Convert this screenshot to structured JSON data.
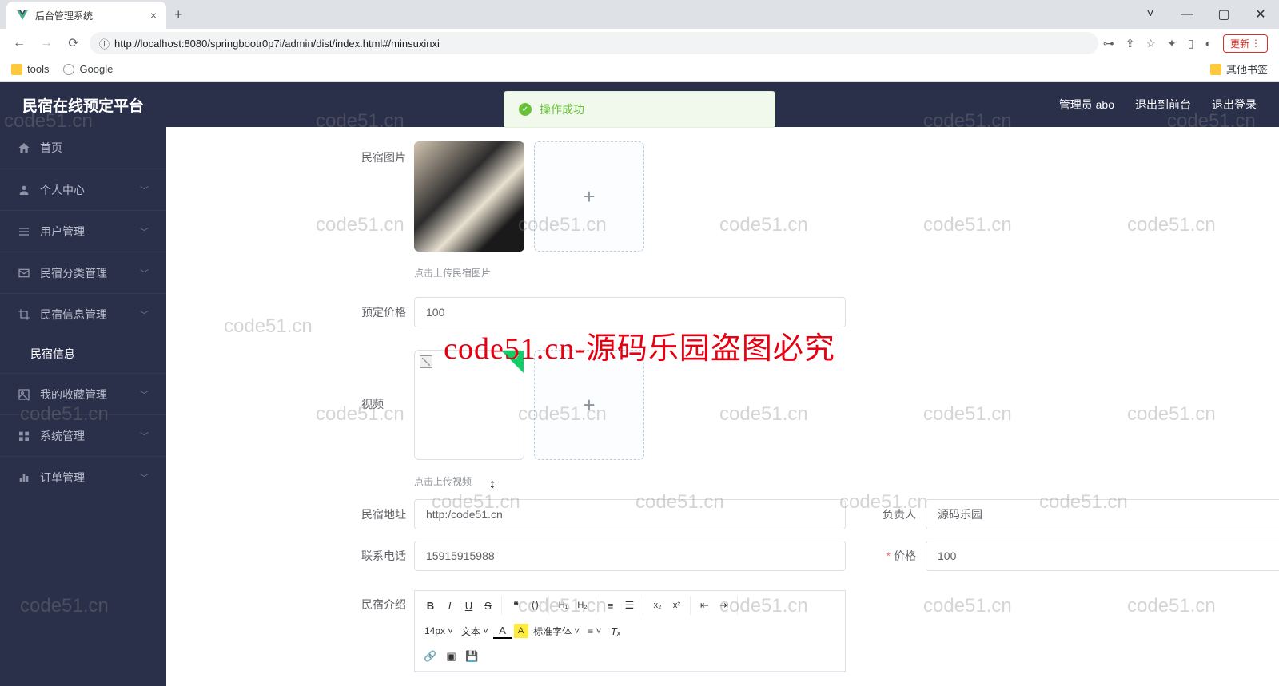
{
  "browser": {
    "tab_title": "后台管理系统",
    "url": "http://localhost:8080/springbootr0p7i/admin/dist/index.html#/minsuxinxi",
    "update_btn": "更新",
    "bookmarks": {
      "tools": "tools",
      "google": "Google",
      "other": "其他书签"
    }
  },
  "header": {
    "title": "民宿在线预定平台",
    "user_label": "管理员 abo",
    "exit_front": "退出到前台",
    "logout": "退出登录"
  },
  "sidebar": {
    "home": "首页",
    "personal": "个人中心",
    "users": "用户管理",
    "category": "民宿分类管理",
    "info_mgmt": "民宿信息管理",
    "info_sub": "民宿信息",
    "favorites": "我的收藏管理",
    "system": "系统管理",
    "orders": "订单管理"
  },
  "form": {
    "image_label": "民宿图片",
    "image_hint": "点击上传民宿图片",
    "price_label": "预定价格",
    "price_value": "100",
    "video_label": "视频",
    "video_hint": "点击上传视频",
    "address_label": "民宿地址",
    "address_value": "http:/code51.cn",
    "owner_label": "负责人",
    "owner_value": "源码乐园",
    "phone_label": "联系电话",
    "phone_value": "15915915988",
    "amount_label": "价格",
    "amount_value": "100",
    "intro_label": "民宿介绍"
  },
  "editor_selects": {
    "fontsize": "14px",
    "fonttype": "文本",
    "fontfamily": "标准字体"
  },
  "toast": {
    "text": "操作成功"
  },
  "watermark_text": "code51.cn",
  "big_watermark": "code51.cn-源码乐园盗图必究"
}
